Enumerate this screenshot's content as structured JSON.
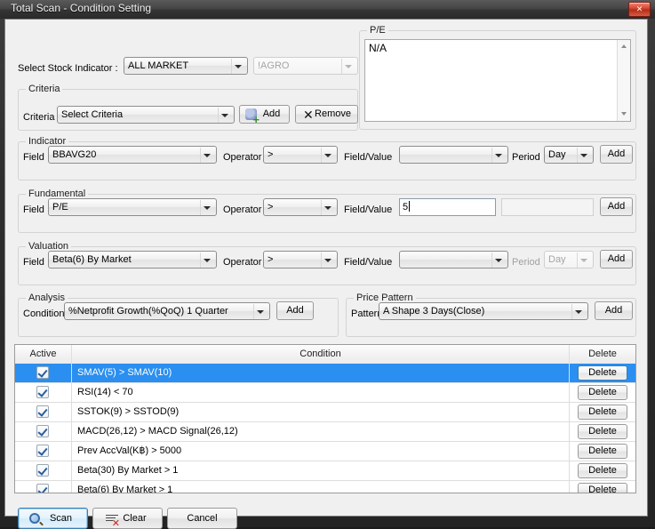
{
  "window": {
    "title": "Total Scan - Condition Setting",
    "close_label": "✕"
  },
  "top": {
    "stock_indicator_label": "Select Stock Indicator :",
    "market_combo_value": "ALL MARKET",
    "sector_combo_value": "!AGRO"
  },
  "pe_panel": {
    "group_title": "P/E",
    "content": "N/A"
  },
  "criteria": {
    "group_title": "Criteria",
    "field_label": "Criteria",
    "combo_value": "Select Criteria",
    "add_label": "Add",
    "remove_label": "Remove"
  },
  "indicator": {
    "group_title": "Indicator",
    "field_label": "Field",
    "field_value": "BBAVG20",
    "operator_label": "Operator",
    "operator_value": ">",
    "fieldvalue_label": "Field/Value",
    "fieldvalue_value": "",
    "period_label": "Period",
    "period_value": "Day",
    "add_label": "Add"
  },
  "fundamental": {
    "group_title": "Fundamental",
    "field_label": "Field",
    "field_value": "P/E",
    "operator_label": "Operator",
    "operator_value": ">",
    "fieldvalue_label": "Field/Value",
    "fieldvalue_value": "5",
    "extra_value": "",
    "add_label": "Add"
  },
  "valuation": {
    "group_title": "Valuation",
    "field_label": "Field",
    "field_value": "Beta(6) By Market",
    "operator_label": "Operator",
    "operator_value": ">",
    "fieldvalue_label": "Field/Value",
    "fieldvalue_value": "",
    "period_label": "Period",
    "period_value": "Day",
    "add_label": "Add"
  },
  "analysis": {
    "group_title": "Analysis",
    "condition_label": "Condition",
    "condition_value": "%Netprofit Growth(%QoQ) 1 Quarter",
    "add_label": "Add"
  },
  "price_pattern": {
    "group_title": "Price Pattern",
    "pattern_label": "Pattern",
    "pattern_value": "A Shape 3 Days(Close)",
    "add_label": "Add"
  },
  "grid": {
    "headers": [
      "Active",
      "Condition",
      "Delete"
    ],
    "delete_label": "Delete",
    "selected_index": 0,
    "rows": [
      {
        "active": true,
        "condition": "SMAV(5) > SMAV(10)"
      },
      {
        "active": true,
        "condition": "RSI(14) < 70"
      },
      {
        "active": true,
        "condition": "SSTOK(9) > SSTOD(9)"
      },
      {
        "active": true,
        "condition": "MACD(26,12) > MACD Signal(26,12)"
      },
      {
        "active": true,
        "condition": "Prev AccVal(K฿) > 5000"
      },
      {
        "active": true,
        "condition": "Beta(30) By Market > 1"
      },
      {
        "active": true,
        "condition": "Beta(6) By Market > 1"
      }
    ]
  },
  "footer": {
    "scan_label": "Scan",
    "clear_label": "Clear",
    "cancel_label": "Cancel"
  },
  "colors": {
    "selection": "#2a8ff0",
    "close_button": "#d84a33",
    "titlebar": "#3d3d3d"
  }
}
